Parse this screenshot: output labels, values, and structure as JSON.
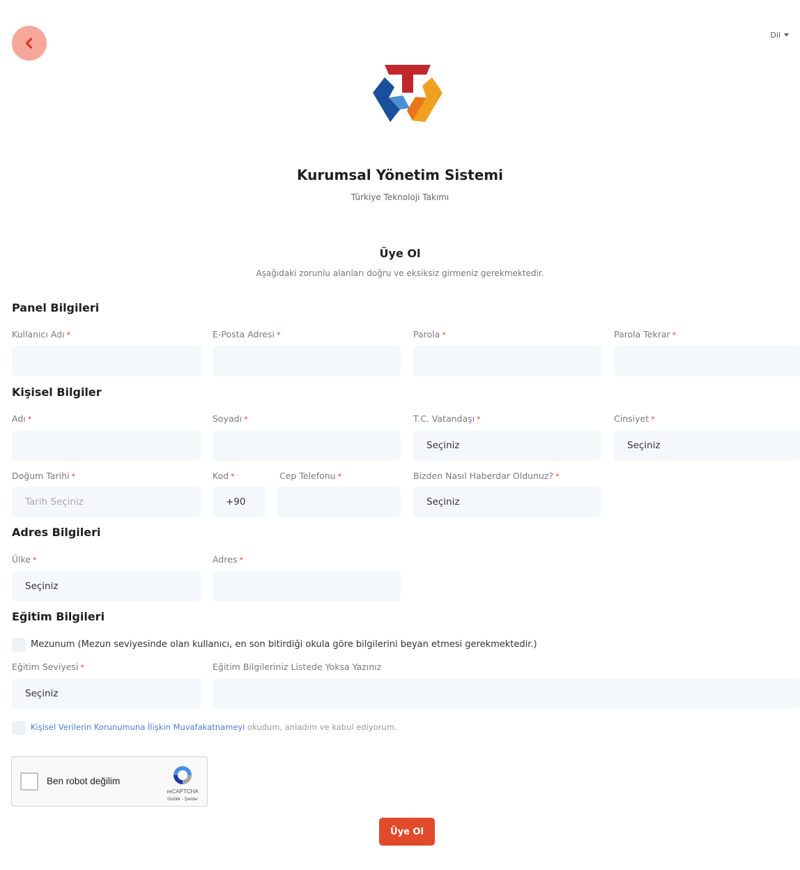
{
  "header": {
    "language_label": "Dil",
    "app_title": "Kurumsal Yönetim Sistemi",
    "app_subtitle": "Türkiye Teknoloji Takımı",
    "form_title": "Üye Ol",
    "form_description": "Aşağıdaki zorunlu alanları doğru ve eksiksiz girmeniz gerekmektedir."
  },
  "colors": {
    "accent": "#e14a2b",
    "back_button": "#f5a89a",
    "input_bg": "#f5f8fa",
    "link": "#4a7fd4"
  },
  "required_mark": "*",
  "panel": {
    "title": "Panel Bilgileri",
    "username_label": "Kullanıcı Adı",
    "email_label": "E-Posta Adresi",
    "password_label": "Parola",
    "password_repeat_label": "Parola Tekrar"
  },
  "personal": {
    "title": "Kişisel Bilgiler",
    "name_label": "Adı",
    "surname_label": "Soyadı",
    "citizen_label": "T.C. Vatandaşı",
    "citizen_value": "Seçiniz",
    "gender_label": "Cinsiyet",
    "gender_value": "Seçiniz",
    "birthdate_label": "Doğum Tarihi",
    "birthdate_placeholder": "Tarih Seçiniz",
    "code_label": "Kod",
    "code_value": "+90",
    "phone_label": "Cep Telefonu",
    "source_label": "Bizden Nasıl Haberdar Oldunuz?",
    "source_value": "Seçiniz"
  },
  "address": {
    "title": "Adres Bilgileri",
    "country_label": "Ülke",
    "country_value": "Seçiniz",
    "address_label": "Adres"
  },
  "education": {
    "title": "Eğitim Bilgileri",
    "graduate_text": "Mezunum (Mezun seviyesinde olan kullanıcı, en son bitirdiği okula göre bilgilerini beyan etmesi gerekmektedir.)",
    "level_label": "Eğitim Seviyesi",
    "level_value": "Seçiniz",
    "other_label": "Eğitim Bilgileriniz Listede Yoksa Yazınız"
  },
  "consent": {
    "link_text": "Kişisel Verilerin Korunumuna İlişkin Muvafakatnameyi",
    "rest_text": " okudum, anladım ve kabul ediyorum."
  },
  "recaptcha": {
    "label": "Ben robot değilim",
    "brand": "reCAPTCHA",
    "links": "Gizlilik - Şartlar"
  },
  "submit_label": "Üye Ol"
}
